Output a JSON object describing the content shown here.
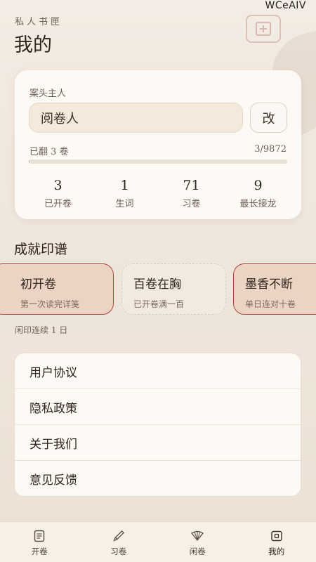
{
  "watermark": "WCeAIV",
  "header": {
    "subtitle": "私人书匣",
    "title": "我的",
    "add_icon": "add-square-icon"
  },
  "profile": {
    "label": "案头主人",
    "name_value": "阅卷人",
    "edit_label": "改",
    "flip_label": "已翻 3 卷",
    "flip_count": "3/9872",
    "progress": 0.0003,
    "stats": [
      {
        "value": "3",
        "label": "已开卷"
      },
      {
        "value": "1",
        "label": "生词"
      },
      {
        "value": "71",
        "label": "习卷"
      },
      {
        "value": "9",
        "label": "最长接龙"
      }
    ]
  },
  "achievements": {
    "title": "成就印谱",
    "items": [
      {
        "title": "初开卷",
        "desc": "第一次读完详笺",
        "earned": true
      },
      {
        "title": "百卷在胸",
        "desc": "已开卷满一百",
        "earned": false
      },
      {
        "title": "墨香不断",
        "desc": "单日连对十卷",
        "earned": true
      }
    ],
    "streak": "闲印连续 1 日"
  },
  "menu": {
    "items": [
      "用户协议",
      "隐私政策",
      "关于我们",
      "意见反馈"
    ]
  },
  "tabs": [
    {
      "label": "开卷",
      "icon": "scroll-icon"
    },
    {
      "label": "习卷",
      "icon": "brush-icon"
    },
    {
      "label": "闲卷",
      "icon": "fan-icon"
    },
    {
      "label": "我的",
      "icon": "profile-icon"
    }
  ],
  "colors": {
    "accent": "#b0453c",
    "background": "#efe6db",
    "card": "#fdfaf6"
  }
}
